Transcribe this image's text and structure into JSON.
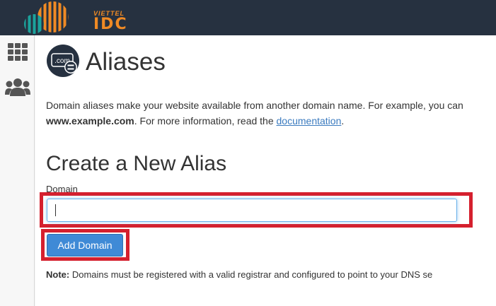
{
  "brand": {
    "sub": "VIETTEL",
    "main": "IDC",
    "accent_color": "#f08a24"
  },
  "sidebar": {
    "items": [
      {
        "icon": "grid-icon"
      },
      {
        "icon": "users-icon"
      }
    ]
  },
  "page": {
    "title": "Aliases",
    "icon_text": ".com",
    "description": {
      "part1": "Domain aliases make your website available from another domain name. For example, you can",
      "bold_domain": "www.example.com",
      "part2": ". For more information, read the ",
      "link": "documentation",
      "part3": "."
    }
  },
  "form": {
    "section_title": "Create a New Alias",
    "domain_label": "Domain",
    "domain_value": "",
    "submit_label": "Add Domain"
  },
  "note": {
    "label": "Note:",
    "text": " Domains must be registered with a valid registrar and configured to point to your DNS se"
  },
  "colors": {
    "header_bg": "#263140",
    "primary_button": "#3f8ad6",
    "highlight": "#d5202e",
    "link": "#3b7bbf"
  }
}
